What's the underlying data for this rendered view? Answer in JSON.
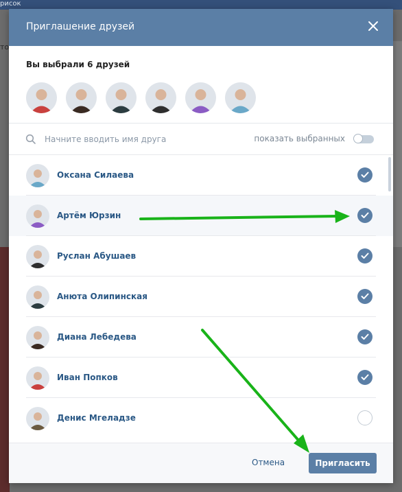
{
  "background": {
    "topbar_text": "рисок",
    "left_text": "то"
  },
  "modal": {
    "title": "Приглашение друзей",
    "selected_count_label": "Вы выбрали 6 друзей",
    "search_placeholder": "Начните вводить имя друга",
    "show_selected_label": "показать выбранных",
    "cancel_label": "Отмена",
    "invite_label": "Пригласить"
  },
  "selected_friends": [
    {
      "name": "Иван Попков",
      "avatar_color": "#c9413e"
    },
    {
      "name": "Диана Лебедева",
      "avatar_color": "#3a2a22"
    },
    {
      "name": "Анюта Олипинская",
      "avatar_color": "#2c3c40"
    },
    {
      "name": "Руслан Абушаев",
      "avatar_color": "#2e2e2e"
    },
    {
      "name": "Артём Юрзин",
      "avatar_color": "#8b5cc4"
    },
    {
      "name": "Оксана Силаева",
      "avatar_color": "#6aa8c8"
    }
  ],
  "friends": [
    {
      "name": "Оксана Силаева",
      "selected": true,
      "avatar_color": "#6aa8c8"
    },
    {
      "name": "Артём Юрзин",
      "selected": true,
      "avatar_color": "#8b5cc4"
    },
    {
      "name": "Руслан Абушаев",
      "selected": true,
      "avatar_color": "#2e2e2e"
    },
    {
      "name": "Анюта Олипинская",
      "selected": true,
      "avatar_color": "#2c3c40"
    },
    {
      "name": "Диана Лебедева",
      "selected": true,
      "avatar_color": "#3a2a22"
    },
    {
      "name": "Иван Попков",
      "selected": true,
      "avatar_color": "#c9413e"
    },
    {
      "name": "Денис Мгеладзе",
      "selected": false,
      "avatar_color": "#6b5a40"
    }
  ],
  "colors": {
    "header": "#5b7fa6",
    "accent": "#5b7fa6",
    "link": "#2a5885",
    "annotation_arrow": "#19b319"
  }
}
